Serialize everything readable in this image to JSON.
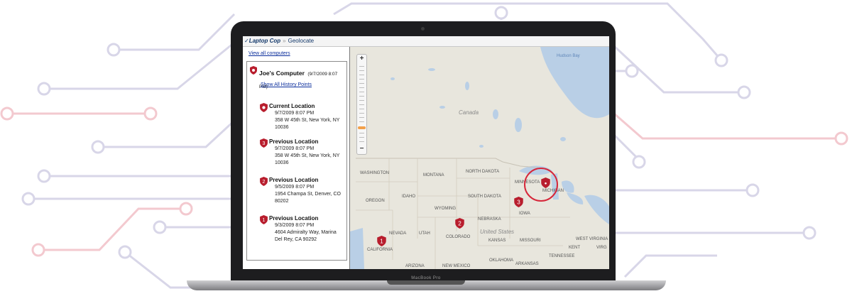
{
  "app": {
    "logo": "Laptop Cop",
    "breadcrumb": "Geolocate"
  },
  "sidebar": {
    "view_all_link": "View all computers",
    "computer_name": "Joe's Computer",
    "computer_date": "(9/7/2009 8:07 PM)",
    "history_link": "Show All History Points",
    "locations": [
      {
        "title": "Current Location",
        "date": "9/7/2009 8:07 PM",
        "address": "358 W 45th St, New York, NY 10036",
        "marker": ""
      },
      {
        "title": "Previous Location",
        "date": "9/7/2009 8:07 PM",
        "address": "358 W 45th St, New York, NY 10036",
        "marker": "3"
      },
      {
        "title": "Previous Location",
        "date": "9/5/2009 8:07 PM",
        "address": "1954 Champa St, Denver, CO 80202",
        "marker": "2"
      },
      {
        "title": "Previous Location",
        "date": "9/3/2009 8:07 PM",
        "address": "4604 Admiralty Way, Marina Del Rey, CA 90292",
        "marker": "1"
      }
    ]
  },
  "map": {
    "zoom_in": "+",
    "zoom_out": "−",
    "labels": {
      "hudson_bay": "Hudson Bay",
      "canada": "Canada",
      "united_states": "United States",
      "washington": "WASHINGTON",
      "montana": "MONTANA",
      "north_dakota": "NORTH DAKOTA",
      "minnesota": "MINNESOTA",
      "oregon": "OREGON",
      "idaho": "IDAHO",
      "south_dakota": "SOUTH DAKOTA",
      "michigan": "MICHIGAN",
      "wyoming": "WYOMING",
      "iowa": "IOWA",
      "nebraska": "NEBRASKA",
      "nevada": "NEVADA",
      "utah": "UTAH",
      "colorado": "COLORADO",
      "kansas": "KANSAS",
      "missouri": "MISSOURI",
      "california": "CALIFORNIA",
      "oklahoma": "OKLAHOMA",
      "arkansas": "ARKANSAS",
      "tennessee": "TENNESSEE",
      "kentucky": "KENT",
      "west_virginia": "WEST VIRGINIA",
      "virginia": "VIRG",
      "new_mexico": "NEW MEXICO",
      "arizona": "ARIZONA"
    },
    "markers": [
      "1",
      "2",
      "3",
      "●"
    ]
  },
  "device": {
    "brand": "MacBook Pro"
  },
  "colors": {
    "accent_red": "#d6273a",
    "circuit_lavender": "#c9c6dd",
    "circuit_pink": "#efbcc4"
  }
}
